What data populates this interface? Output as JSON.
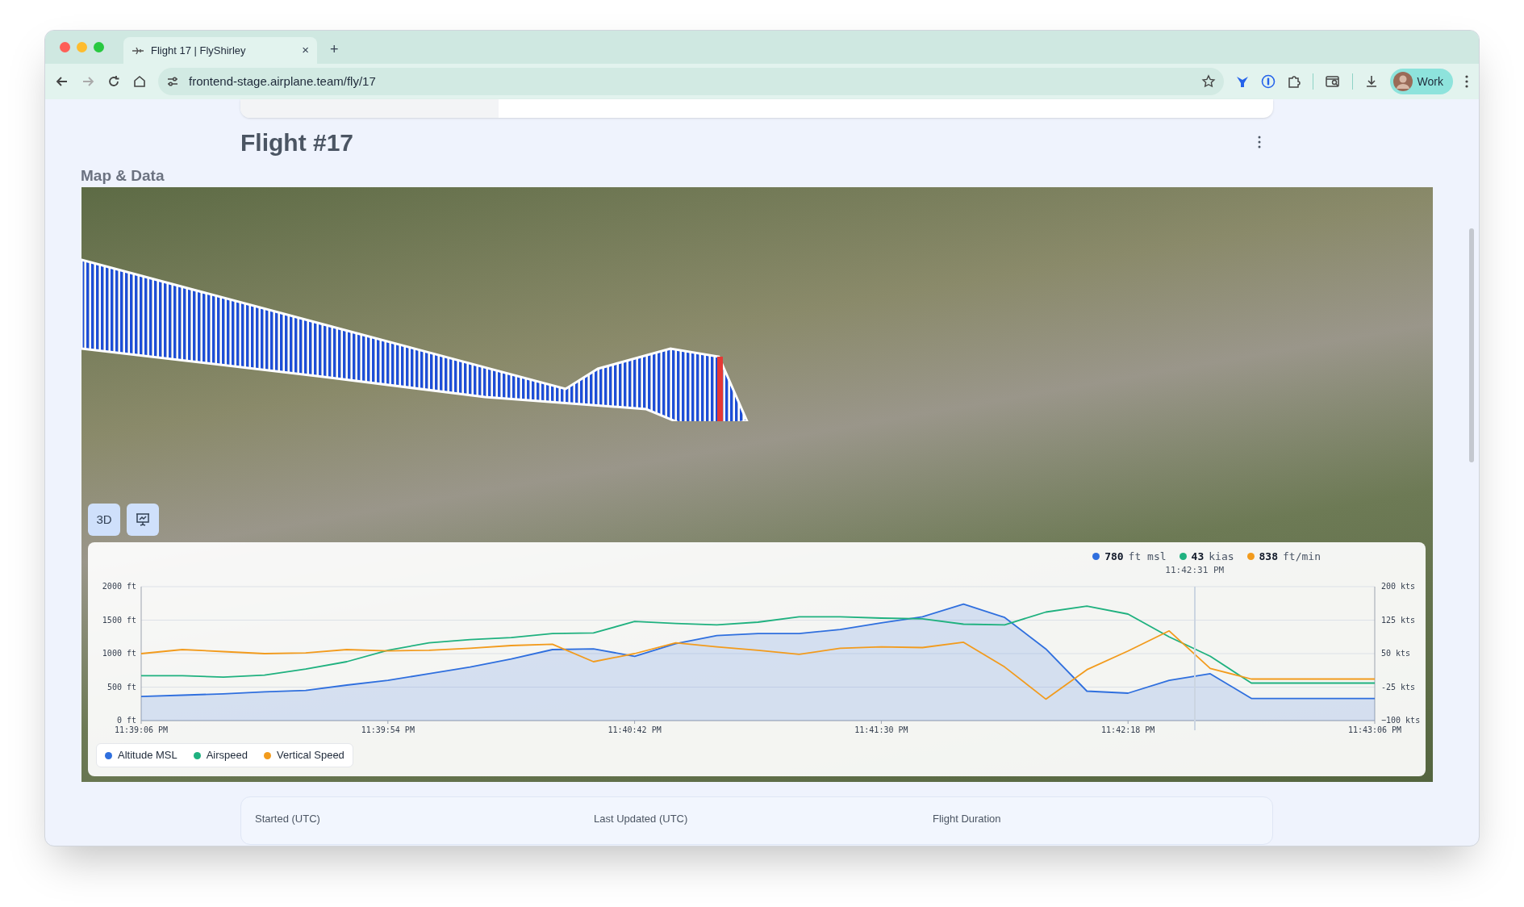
{
  "browser": {
    "tabs": [
      {
        "title": "Flight 17 | FlyShirley",
        "close": "×",
        "selected": true
      }
    ],
    "new_tab": "+",
    "url": "frontend-stage.airplane.team/fly/17",
    "profile": "Work"
  },
  "page": {
    "title": "Flight #17",
    "section": "Map & Data"
  },
  "map": {
    "buttons": [
      {
        "kind": "text",
        "label": "3D"
      },
      {
        "kind": "chart-icon"
      }
    ]
  },
  "chart": {
    "readouts": [
      {
        "value": "780",
        "unit": "ft msl",
        "color": "#2f6fde"
      },
      {
        "value": "43",
        "unit": "kias",
        "color": "#1fb17f"
      },
      {
        "value": "838",
        "unit": "ft/min",
        "color": "#f29b1d"
      }
    ],
    "cursor": {
      "level": 0.854
    },
    "right_axis_ticks": [
      "200 kts",
      "125 kts",
      "50 kts",
      "-25 kts",
      "−100 kts"
    ],
    "chart_data": {
      "type": "line",
      "ylim": [
        0,
        2000
      ],
      "grid": true,
      "categories": [
        "11:39:06 PM",
        null,
        null,
        null,
        null,
        null,
        "11:39:54 PM",
        null,
        null,
        null,
        null,
        null,
        "11:40:42 PM",
        null,
        null,
        null,
        null,
        null,
        "11:41:30 PM",
        null,
        null,
        null,
        null,
        null,
        "11:42:18 PM",
        null,
        null,
        null,
        null,
        null,
        "11:43:06 PM"
      ],
      "yticks": [
        {
          "value": 0,
          "label": "0 ft"
        },
        {
          "value": 500,
          "label": "500 ft"
        },
        {
          "value": 1000,
          "label": "1000 ft"
        },
        {
          "value": 1500,
          "label": "1500 ft"
        },
        {
          "value": 2000,
          "label": "2000 ft"
        }
      ],
      "series": [
        {
          "name": "Altitude MSL",
          "color": "#2f6fde",
          "type": "area",
          "values": [
            360,
            380,
            400,
            430,
            450,
            530,
            600,
            700,
            800,
            920,
            1060,
            1070,
            960,
            1150,
            1270,
            1300,
            1300,
            1360,
            1460,
            1550,
            1740,
            1540,
            1070,
            440,
            410,
            600,
            700,
            330,
            330,
            330,
            330
          ]
        },
        {
          "name": "Airspeed",
          "color": "#1fb17f",
          "type": "line",
          "values": [
            670,
            670,
            650,
            680,
            770,
            880,
            1050,
            1160,
            1210,
            1240,
            1300,
            1310,
            1480,
            1450,
            1430,
            1470,
            1550,
            1550,
            1530,
            1520,
            1440,
            1430,
            1620,
            1710,
            1590,
            1250,
            960,
            560,
            560,
            560,
            560
          ]
        },
        {
          "name": "Vertical Speed",
          "color": "#f29b1d",
          "type": "line",
          "values": [
            1000,
            1060,
            1030,
            1000,
            1010,
            1060,
            1040,
            1050,
            1080,
            1120,
            1140,
            880,
            1000,
            1160,
            1100,
            1050,
            990,
            1080,
            1100,
            1090,
            1170,
            800,
            320,
            760,
            1040,
            1340,
            780,
            620,
            620,
            620,
            620
          ]
        }
      ],
      "annotations": [
        "11:42:31 PM"
      ]
    }
  },
  "stats": [
    "Started (UTC)",
    "Last Updated (UTC)",
    "Flight Duration"
  ]
}
